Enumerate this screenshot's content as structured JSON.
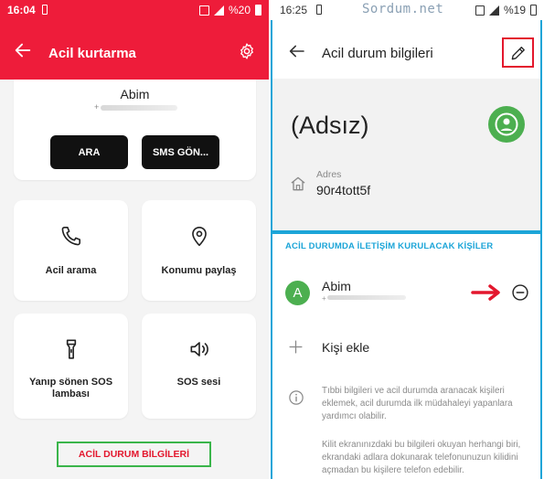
{
  "left": {
    "status": {
      "time": "16:04",
      "battery": "%20"
    },
    "appbar": {
      "title": "Acil kurtarma"
    },
    "contact": {
      "name": "Abim",
      "phone_prefix": "+",
      "call_label": "ARA",
      "sms_label": "SMS GÖN..."
    },
    "tiles": [
      {
        "label": "Acil arama",
        "icon": "phone-icon"
      },
      {
        "label": "Konumu paylaş",
        "icon": "location-pin-icon"
      },
      {
        "label": "Yanıp sönen SOS lambası",
        "icon": "flashlight-icon"
      },
      {
        "label": "SOS sesi",
        "icon": "speaker-icon"
      }
    ],
    "bottom_link": "ACİL DURUM BİLGİLERİ"
  },
  "right": {
    "status": {
      "time": "16:25",
      "battery": "%19"
    },
    "watermark": "Sordum.net",
    "appbar": {
      "title": "Acil durum bilgileri"
    },
    "header": {
      "name": "(Adsız)",
      "address_label": "Adres",
      "address_value": "90r4tott5f"
    },
    "section_title": "ACİL DURUMDA İLETİŞİM KURULACAK KİŞİLER",
    "contact": {
      "initial": "A",
      "name": "Abim",
      "phone_prefix": "+"
    },
    "add_contact": "Kişi ekle",
    "info": {
      "paragraph1": "Tıbbi bilgileri ve acil durumda aranacak kişileri eklemek, acil durumda ilk müdahaleyi yapanlara yardımcı olabilir.",
      "paragraph2": "Kilit ekranınızdaki bu bilgileri okuyan herhangi biri, ekrandaki adlara dokunarak telefonunuzun kilidini açmadan bu kişilere telefon edebilir."
    }
  },
  "colors": {
    "brand_red": "#ee1c3a",
    "accent_blue": "#1ca5d8",
    "avatar_green": "#4caf50",
    "highlight_green": "#3ab54a",
    "annotation_red": "#e3172d"
  }
}
